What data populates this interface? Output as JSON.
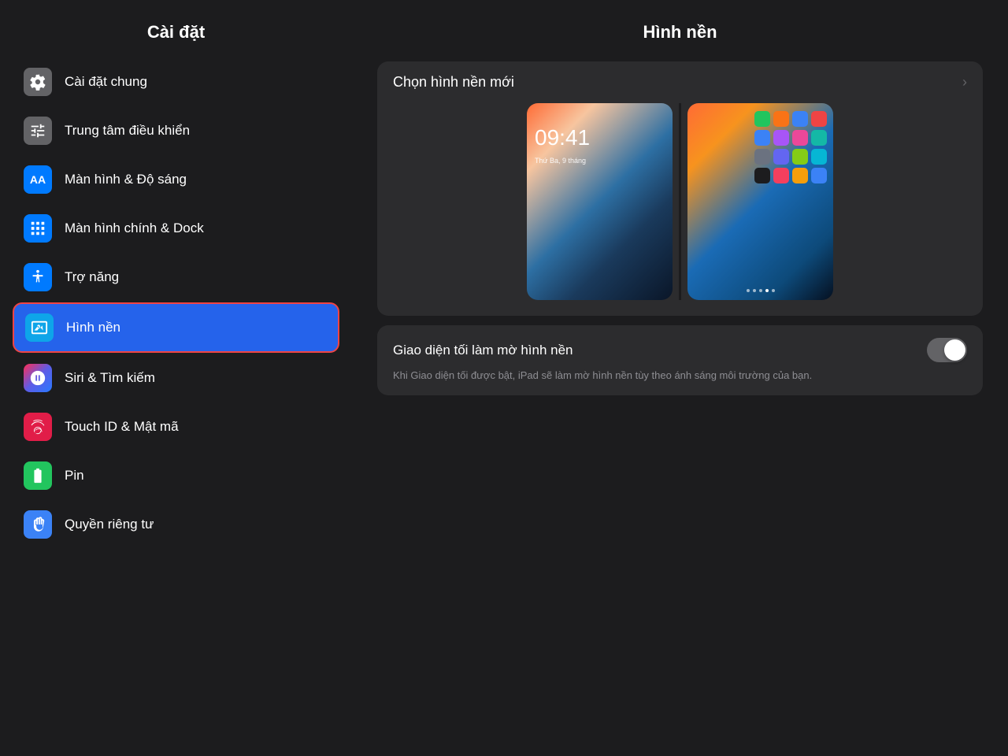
{
  "sidebar": {
    "title": "Cài đặt",
    "items": [
      {
        "id": "cai-dat-chung",
        "label": "Cài đặt chung",
        "icon_type": "gear",
        "icon_bg": "gray",
        "active": false
      },
      {
        "id": "trung-tam-dieu-khien",
        "label": "Trung tâm điều khiển",
        "icon_type": "sliders",
        "icon_bg": "gray2",
        "active": false
      },
      {
        "id": "man-hinh-do-sang",
        "label": "Màn hình & Độ sáng",
        "icon_type": "text-aa",
        "icon_bg": "blue",
        "active": false
      },
      {
        "id": "man-hinh-chinh-dock",
        "label": "Màn hình chính & Dock",
        "icon_type": "grid",
        "icon_bg": "blue2",
        "active": false
      },
      {
        "id": "tro-nang",
        "label": "Trợ năng",
        "icon_type": "accessibility",
        "icon_bg": "blue3",
        "active": false
      },
      {
        "id": "hinh-nen",
        "label": "Hình nền",
        "icon_type": "wallpaper",
        "icon_bg": "blue-wallpaper",
        "active": true
      },
      {
        "id": "siri-tim-kiem",
        "label": "Siri & Tìm kiếm",
        "icon_type": "siri",
        "icon_bg": "siri",
        "active": false
      },
      {
        "id": "touch-id-mat-ma",
        "label": "Touch ID & Mật mã",
        "icon_type": "fingerprint",
        "icon_bg": "touchid",
        "active": false
      },
      {
        "id": "pin",
        "label": "Pin",
        "icon_type": "battery",
        "icon_bg": "battery",
        "active": false
      },
      {
        "id": "quyen-rieng-tu",
        "label": "Quyền riêng tư",
        "icon_type": "hand",
        "icon_bg": "privacy",
        "active": false
      }
    ]
  },
  "main": {
    "title": "Hình nền",
    "choose_wallpaper": {
      "label": "Chọn hình nền mới",
      "chevron": "›"
    },
    "lock_screen": {
      "time": "09:41",
      "date": "Thứ Ba, 9 tháng"
    },
    "toggle": {
      "label": "Giao diện tối làm mờ hình nền",
      "description": "Khi Giao diện tối được bật, iPad sẽ làm mờ hình nền tùy theo ánh sáng môi trường của bạn.",
      "value": false
    }
  }
}
